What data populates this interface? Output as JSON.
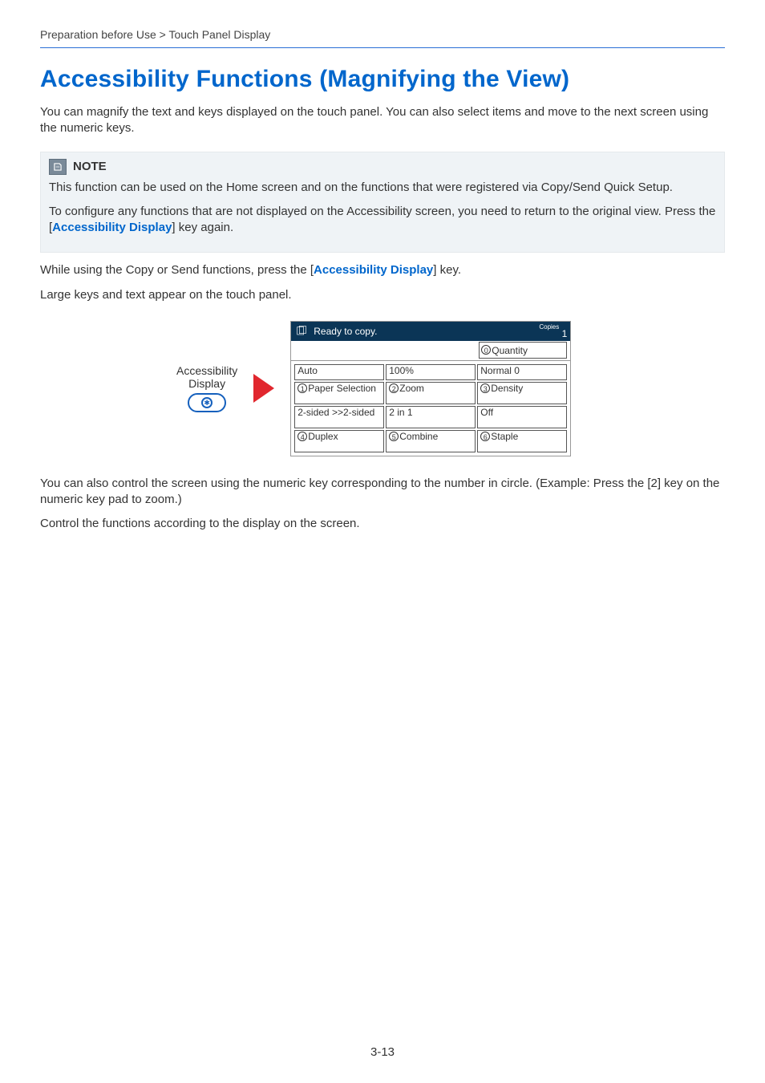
{
  "breadcrumb": "Preparation before Use > Touch Panel Display",
  "heading": "Accessibility Functions (Magnifying the View)",
  "intro": "You can magnify the text and keys displayed on the touch panel. You can also select items and move to the next screen using the numeric keys.",
  "note": {
    "title": "NOTE",
    "para1": "This function can be used on the Home screen and on the functions that were registered via Copy/Send Quick Setup.",
    "para2_pre": "To configure any functions that are not displayed on the Accessibility screen, you need to return to the original view. Press the [",
    "para2_link": "Accessibility Display",
    "para2_post": "] key again."
  },
  "body1_pre": "While using the Copy or Send functions, press the [",
  "body1_link": "Accessibility Display",
  "body1_post": "] key.",
  "body2": "Large keys and text appear on the touch panel.",
  "keylabel_line1": "Accessibility",
  "keylabel_line2": "Display",
  "panel": {
    "status": "Ready to copy.",
    "copies_label": "Copies",
    "copies_value": "1",
    "quantity": {
      "num": "0",
      "label": "Quantity"
    },
    "rows": [
      [
        {
          "value": "Auto"
        },
        {
          "value": "100%"
        },
        {
          "value": "Normal 0"
        }
      ],
      [
        {
          "num": "1",
          "label": "Paper Selection"
        },
        {
          "num": "2",
          "label": "Zoom"
        },
        {
          "num": "3",
          "label": "Density"
        }
      ],
      [
        {
          "value": "2-sided >>2-sided"
        },
        {
          "value": "2 in 1"
        },
        {
          "value": "Off"
        }
      ],
      [
        {
          "num": "4",
          "label": "Duplex"
        },
        {
          "num": "5",
          "label": "Combine"
        },
        {
          "num": "6",
          "label": "Staple"
        }
      ]
    ]
  },
  "body3": "You can also control the screen using the numeric key corresponding to the number in circle. (Example: Press the [2] key on the numeric key pad to zoom.)",
  "body4": "Control the functions according to the display on the screen.",
  "page_number": "3-13"
}
